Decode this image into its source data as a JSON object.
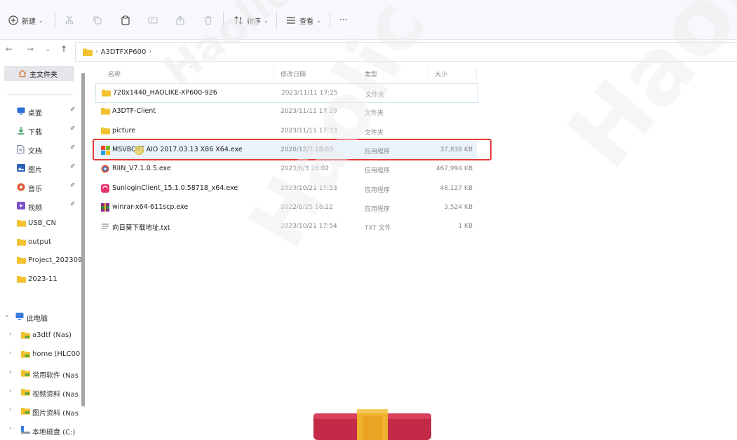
{
  "toolbar": {
    "new_label": "新建",
    "sort_label": "排序",
    "view_label": "查看",
    "more_label": "···"
  },
  "address": {
    "path": [
      "A3DTFXP600"
    ]
  },
  "nav": {
    "home_label": "主文件夹",
    "quick_access": [
      {
        "label": "桌面",
        "icon": "desktop-icon",
        "color": "#2f6fd6"
      },
      {
        "label": "下载",
        "icon": "download-icon",
        "color": "#2c9b5a"
      },
      {
        "label": "文档",
        "icon": "document-icon",
        "color": "#6b7f99"
      },
      {
        "label": "图片",
        "icon": "pictures-icon",
        "color": "#2a62b8"
      },
      {
        "label": "音乐",
        "icon": "music-icon",
        "color": "#e05a3a"
      },
      {
        "label": "视频",
        "icon": "video-icon",
        "color": "#7a4fc9"
      }
    ],
    "folders": [
      "USB_CN",
      "output",
      "Project_202309",
      "2023-11"
    ],
    "this_pc": "此电脑",
    "drives": [
      "a3dtf (Nas)",
      "home (HLC00",
      "常用软件 (Nas",
      "视频资料 (Nas",
      "图片资料 (Nas",
      "本地磁盘 (C:)"
    ]
  },
  "columns": {
    "name": "名称",
    "date": "修改日期",
    "type": "类型",
    "size": "大小"
  },
  "files": [
    {
      "name": "720x1440_HAOLIKE-XP600-926",
      "date": "2023/11/11 17:25",
      "type": "文件夹",
      "size": "",
      "icon": "folder-icon"
    },
    {
      "name": "A3DTF-Client",
      "date": "2023/11/11 17:29",
      "type": "文件夹",
      "size": "",
      "icon": "folder-icon"
    },
    {
      "name": "picture",
      "date": "2023/11/11 17:33",
      "type": "文件夹",
      "size": "",
      "icon": "folder-icon"
    },
    {
      "name": "MSVBCRT AIO 2017.03.13 X86 X64.exe",
      "date": "2020/12/7 18:03",
      "type": "应用程序",
      "size": "37,838 KB",
      "icon": "msvbcrt-icon"
    },
    {
      "name": "RIIN_V7.1.0.5.exe",
      "date": "2023/6/3 16:02",
      "type": "应用程序",
      "size": "467,994 KB",
      "icon": "riin-icon"
    },
    {
      "name": "SunloginClient_15.1.0.58718_x64.exe",
      "date": "2023/10/21 17:53",
      "type": "应用程序",
      "size": "48,127 KB",
      "icon": "sunlogin-icon"
    },
    {
      "name": "winrar-x64-611scp.exe",
      "date": "2022/8/25 16:22",
      "type": "应用程序",
      "size": "3,524 KB",
      "icon": "winrar-icon"
    },
    {
      "name": "向日葵下载地址.txt",
      "date": "2023/10/21 17:54",
      "type": "TXT 文件",
      "size": "1 KB",
      "icon": "text-file-icon"
    }
  ],
  "watermark": "Haolic"
}
